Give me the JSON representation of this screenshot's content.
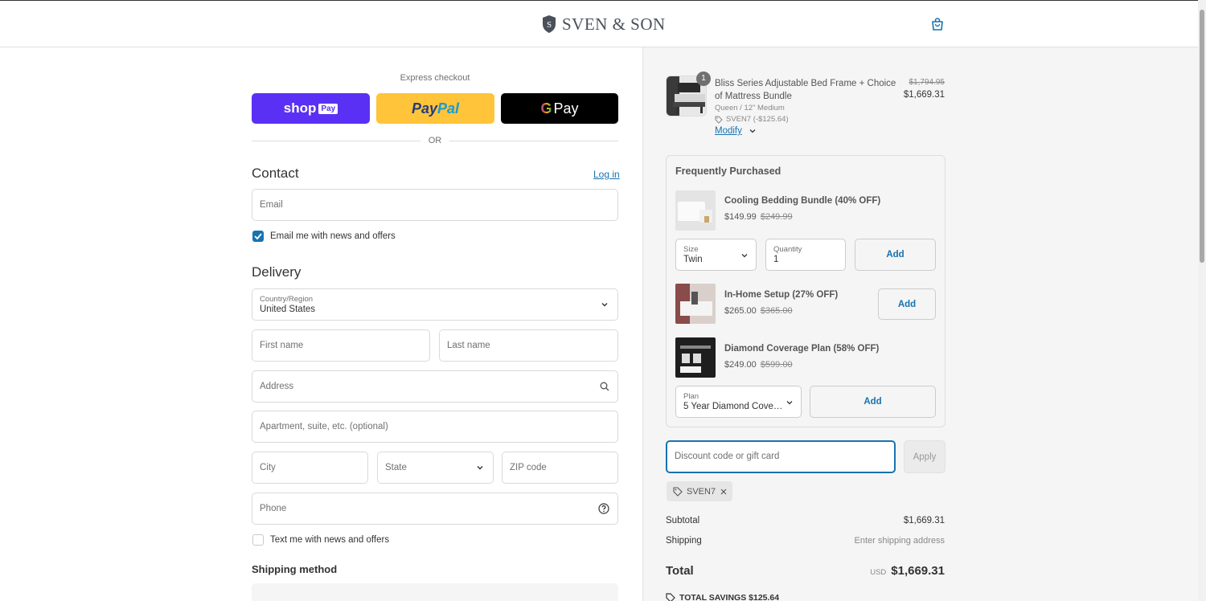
{
  "header": {
    "brand": "SVEN & SON",
    "cart_icon": "shopping-bag-icon"
  },
  "express": {
    "label": "Express checkout",
    "shop_pay": {
      "text": "shop",
      "badge": "Pay"
    },
    "paypal": {
      "part1": "Pay",
      "part2": "Pal"
    },
    "gpay": {
      "g": "G",
      "text": "Pay"
    },
    "or": "OR"
  },
  "contact": {
    "title": "Contact",
    "login": "Log in",
    "email_placeholder": "Email",
    "newsletter_label": "Email me with news and offers",
    "newsletter_checked": true
  },
  "delivery": {
    "title": "Delivery",
    "country_label": "Country/Region",
    "country_value": "United States",
    "first_name": "First name",
    "last_name": "Last name",
    "address": "Address",
    "apartment": "Apartment, suite, etc. (optional)",
    "city": "City",
    "state": "State",
    "zip": "ZIP code",
    "phone": "Phone",
    "sms_label": "Text me with news and offers",
    "sms_checked": false
  },
  "shipping_method": {
    "title": "Shipping method"
  },
  "cart": {
    "item": {
      "quantity": "1",
      "name": "Bliss Series Adjustable Bed Frame + Choice of Mattress Bundle",
      "variant": "Queen / 12\" Medium",
      "discount": "SVEN7 (-$125.64)",
      "modify": "Modify",
      "old_price": "$1,794.95",
      "price": "$1,669.31"
    },
    "frequently": {
      "title": "Frequently Purchased",
      "items": [
        {
          "name": "Cooling Bedding Bundle (40% OFF)",
          "price": "$149.99",
          "old_price": "$249.99",
          "select_label": "Size",
          "select_value": "Twin",
          "qty_label": "Quantity",
          "qty_value": "1",
          "add": "Add"
        },
        {
          "name": "In-Home Setup (27% OFF)",
          "price": "$265.00",
          "old_price": "$365.00",
          "add": "Add"
        },
        {
          "name": "Diamond Coverage Plan (58% OFF)",
          "price": "$249.00",
          "old_price": "$599.00",
          "select_label": "Plan",
          "select_value": "5 Year Diamond Covera...",
          "add": "Add"
        }
      ]
    },
    "discount_placeholder": "Discount code or gift card",
    "apply": "Apply",
    "applied_code": "SVEN7",
    "subtotal_label": "Subtotal",
    "subtotal": "$1,669.31",
    "shipping_label": "Shipping",
    "shipping_value": "Enter shipping address",
    "total_label": "Total",
    "currency": "USD",
    "total": "$1,669.31",
    "savings": "TOTAL SAVINGS  $125.64"
  },
  "colors": {
    "accent": "#1773b0",
    "shop_pay": "#5a31f4",
    "paypal": "#ffc439",
    "panel": "#f5f5f5"
  }
}
